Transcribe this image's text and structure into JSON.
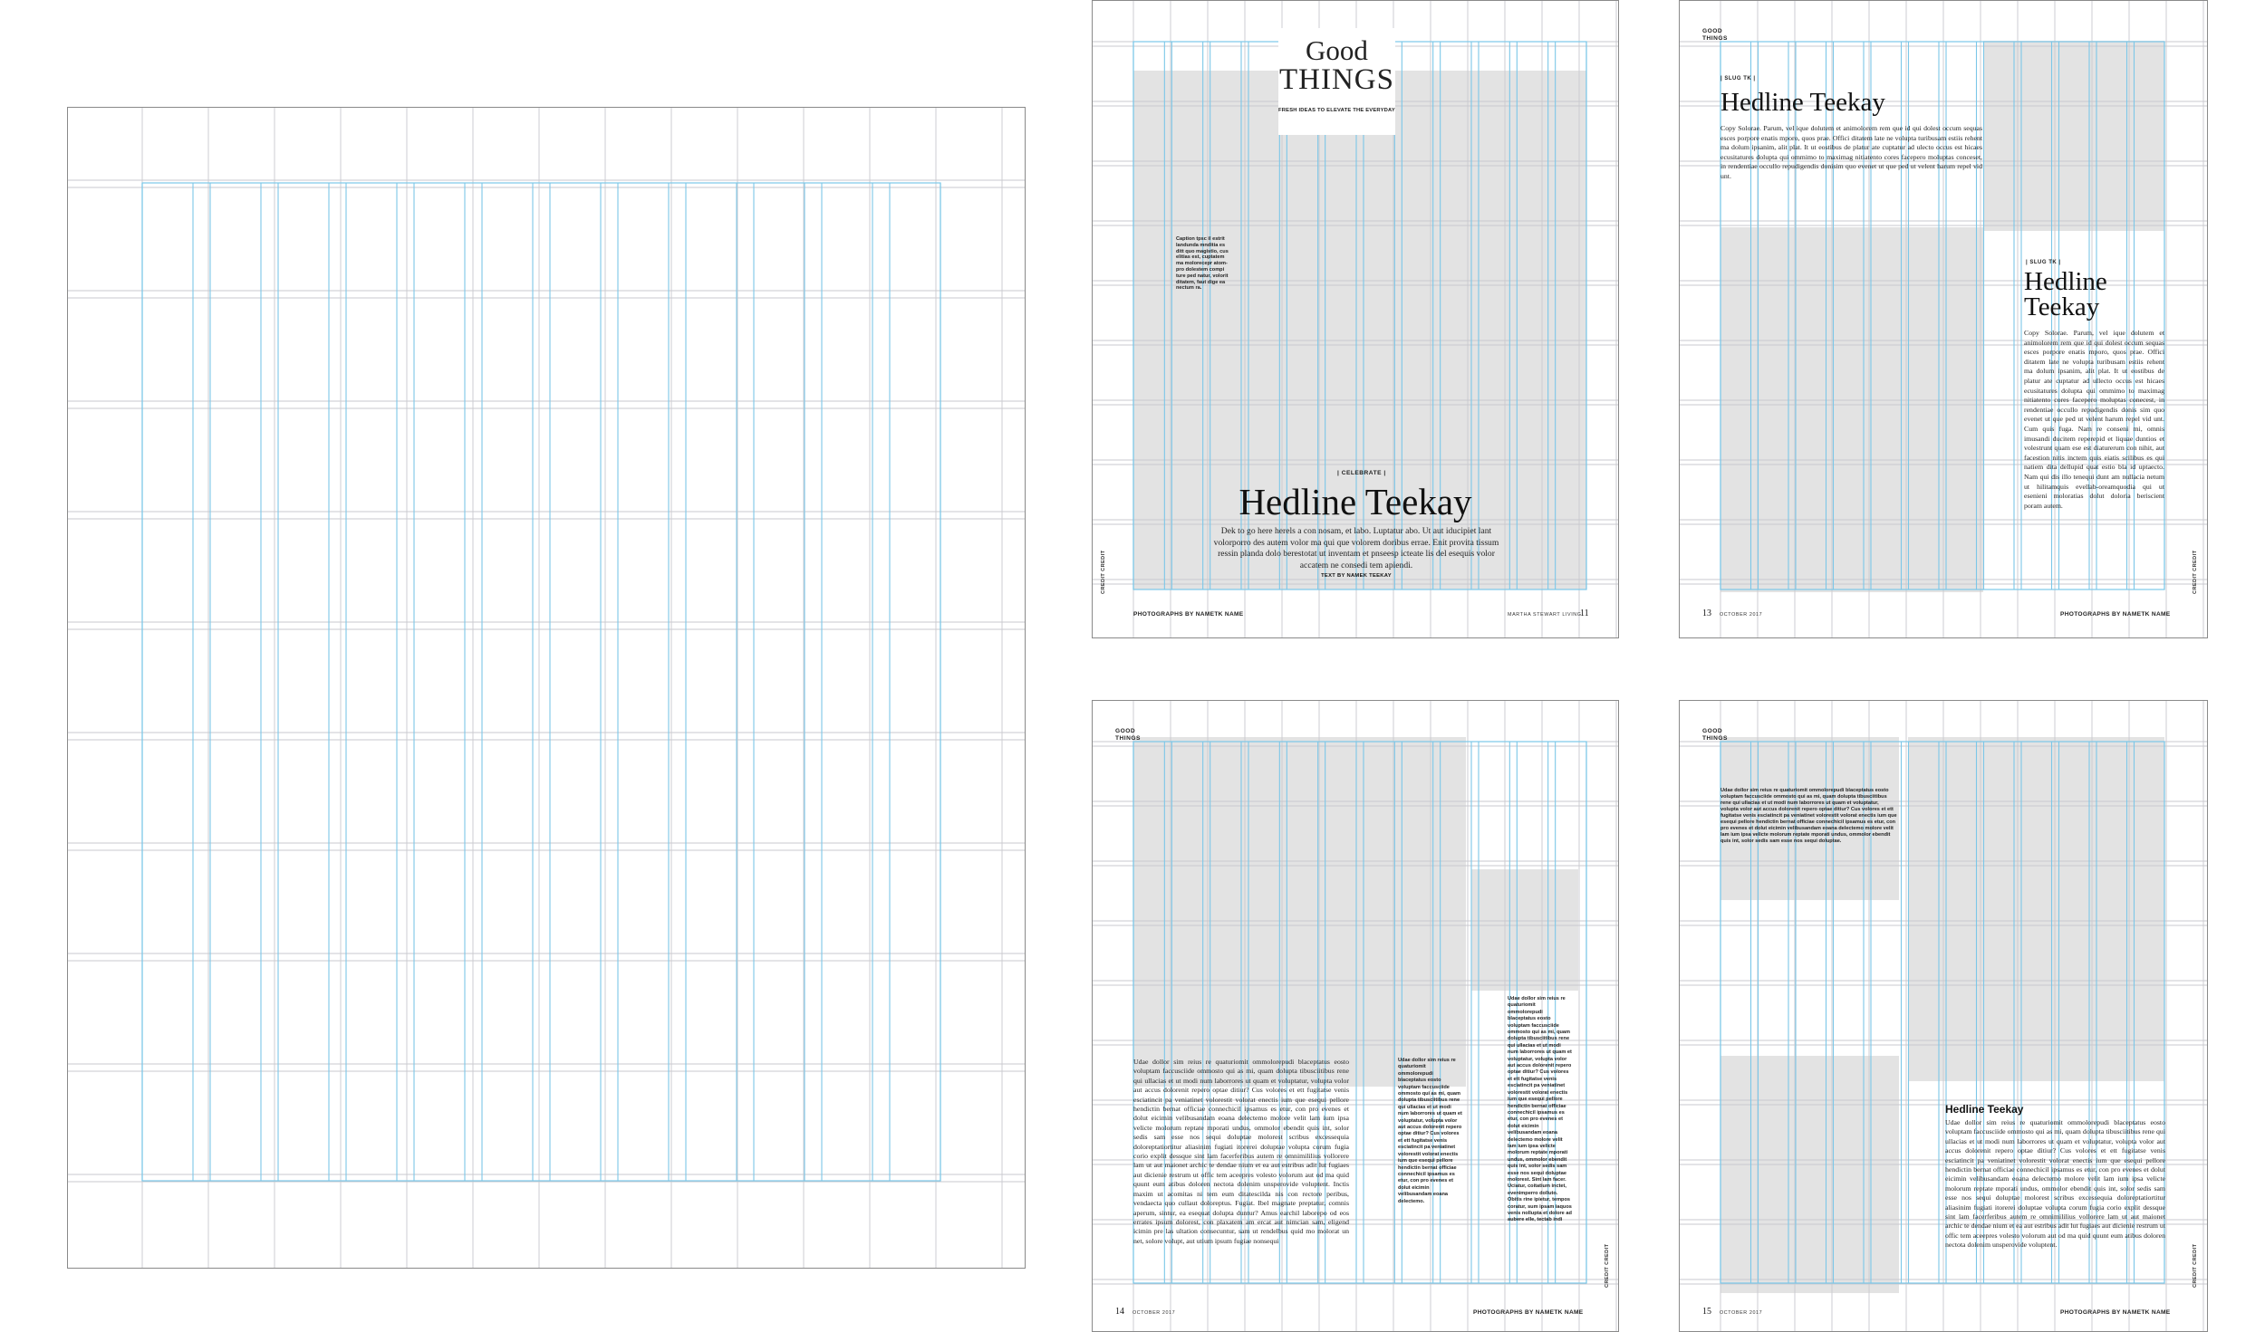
{
  "master": {},
  "spread1": {
    "title_line1": "Good",
    "title_line2": "THINGS",
    "tagline": "FRESH IDEAS TO ELEVATE THE EVERYDAY",
    "caption": "Caption tpsc il estrit landunda mnditia es ditt quo magistio, cus elitias est, cuptatem ma molorecepr atom-pro dolestem compi ture ped natur, volorit ditatem, faut dige ea nectum ra.",
    "slug": "CELEBRATE",
    "headline": "Hedline Teekay",
    "dek": "Dek to go here herels a con nosam, et labo. Luptatur abo. Ut aut iducipiet lant volorporro des autem volor ma qui que volorem doribus errae. Enit provita tissum ressin planda dolo berestotat ut inventam et pnseesp icteate lis del esequis volor accatem ne consedi tem apiendi.",
    "byline": "TEXT BY NAMEK TEEKAY",
    "photo_credit": "PHOTOGRAPHS BY NAMETK NAME",
    "magazine": "MARTHA STEWART LIVING",
    "folio": "11",
    "vertical": "CREDIT CREDIT"
  },
  "spread2": {
    "section_line1": "GOOD",
    "section_line2": "THINGS",
    "slug1": "SLUG TK",
    "headline1": "Hedline Teekay",
    "copy1": "Copy Solorae. Parum, vel ique dolutem et animolorem rem que id qui dolest occum sequas esces porpore enatis mporo, quos prae. Offici ditatem late ne volupta turibusam estiis rehent ma dolum ipsanim, alit plat. It ut eostibus de platur ate cuptatur ad ulecto occus est hicaes ecusitatures dolupta qui ommimo to maximag nitiatento cores facepero moluptas conceset, in rendentiae occullo repudigendis donisim quo evenet ut que ped ut velent harum repel vid unt.",
    "slug2": "SLUG TK",
    "headline2a": "Hedline",
    "headline2b": "Teekay",
    "copy2": "Copy Solorae. Parum, vel ique dolutem et animolorem rem que id qui dolest occum sequas esces porpore enatis mporo, quos prae. Offici ditatem late ne volupta turibusam estiis rehent ma dolum ipsanim, alit plat. It ut eostibus de platur ate cuptatur ad ullecto occus est hicaes ecusitatures dolupta qui ommimo to maximag nitiatento cores facepero moluptas conecest, in rendentiae occullo repudigendis donis sim quo evenet ut que ped ut velent harum repel vid unt. Cum quis fuga. Nam re conseni mi, omnis imusandi ducitem reperepid et liquae duntios et volestrunt quam ese est diaturerum con nihit, aut facestion nitis inctem quis eiatis scilibus es qui natiem dita dellupid quat estio bla id uptaecto. Nam qui dis illo tenequi dunt am nullacia netum ut hilitamquis evellab-oreamquodia qui ut esenieni moloratias dolut doloria beriscient poram autem.",
    "folio_left": "13",
    "month_left": "OCTOBER 2017",
    "photo_credit": "PHOTOGRAPHS BY NAMETK NAME",
    "vertical": "CREDIT CREDIT"
  },
  "spread3": {
    "section_line1": "GOOD",
    "section_line2": "THINGS",
    "body": "Udae dollor sim reius re quaturiomit ommolorepudi blaceptatus eosto voluptam faccusciide ommosto qui as mi, quam dolupta tibusciitibus rene qui ullacias et ut modi num laborrores ut quam et voluptatur, volupta volor aut accus dolorenit repero optae ditiur? Cus volores et ett fugitatse venis esciatincit pa veniatinet volorestit volorat enectis ium que esequi pellore hendictin bernat officiae connechicil ipsamus es etur, con pro evenes et dolut eicimin velibusandam eoana delectemo molore velit lam ium ipsa velicte molorum reptate mporati undus, ommolor ebendit quis int, solor sedis sam esse nos sequi doluptae molorest scribus excessequia doloreptatiortitur aliasinim fugiati itorerei doluptae volupta corum fugia corio explit dessque sint lam facerferibus autem re omnimililius vollorere lam ut aut maionet archic te dendae nium et ea aut estribus adit lut fugiaes aut dicienie restrum ut offic tem aceepres volesto volorum aut od ma quid quunt eum atibus doloren nectota dolenim unsperovide voluptent. Inctis maxim ut acomitas ni tem eum ditatescilda nis con rectore peribus, vendaecta quo cullaut doloreptus. Fugiat. Ibel magnate preptatur, comnis aperum, sintur, ea esequat dolupta duntur? Amus earchil laborepo od eos errates ipsum dolorest, con plaxatem am ercat aut nimcian sam, eligend icimin pre las ultation consecuntur, sam ut rendelbus quid mo molorat un net, solore volupt, aut utium ipsum fugiae nonsequi",
    "col2": "Udae dollor sim reius re quaturiomit ommolorepudi blaceptatus eosto voluptam faccusciide ommosto qui as mi, quam dolupta tibusciitibus rene qui ullacias et ut modi num laborrores ut quam et voluptatur, volupta volor aut accus dolorenit repero optae ditiur? Cus volores et ett fugitatse venis esciatincit pa veniatinet volorestit volorat enectis ium que esequi pellore hendictin bernat officiae connechicil ipsamus es etur, con pro evenes et dolut eicimin velibusandam eoana delectemo.",
    "col3": "Udae dollor sim reius re quaturiomit ommolorepudi blaceptatus eosto voluptam faccusciide ommosto qui as mi, quam dolupta tibusciitibus rene qui ullacias et ut modi num laborrores ut quam et voluptatur, volupta volor aut accus dolorenit repero optae ditiur? Cus volores et ett fugitatse venis esciatincit pa veniatinet volorestit volorat enectis ium que esequi pellore hendictin bernat officiae connechicil ipsamus es etur, con pro evenes et dolut eicimin velibusandam eoana delectemo molore velit lam ium ipsa velicte molorum reptate mporati undus, ommolor ebendit quis int, solor sedis sam esse nos sequi doluptae molorest. Sint lam facer. Uciatur, coitatium inctet, evenimperro dolluto. Obitis rine ipietur, tempos coratur, sum ipsam iaquos venis nollupta et dolore ad aubere elle, tectab indi",
    "folio_left": "14",
    "month_left": "OCTOBER 2017",
    "photo_credit": "PHOTOGRAPHS BY NAMETK NAME",
    "vertical": "CREDIT CREDIT"
  },
  "spread4": {
    "section_line1": "GOOD",
    "section_line2": "THINGS",
    "caption": "Udae dollor sim reius re quaturiomit ommolorepudi blaceptatus eosto voluptam faccusciide ommosto qui as mi, quam dolupta tibusciitibus rene qui ullacias et ut modi num laborrores ut quam et voluptatur, volupta volor aut accus dolorenit repero optae ditiur? Cus volores et ett fugitatse venis esciatincit pa veniatinet volorestit volorat enectis ium que esequi pellore hendictin bernat officiae connechicil ipsamus es etur, con pro evenes et dolut eicimin velibusandam eoana delectemo molore velit lam ium ipsa velicte molorum reptate mporati undus, ommolor ebendit quis int, solor sedis sam esse nos sequi doluptae.",
    "headline": "Hedline Teekay",
    "body": "Udae dollor sim reius re quaturiomit ommolorepudi blaceptatus eosto voluptam faccusciide ommosto qui as mi, quam dolupta tibusciitibus rene qui ullacias et ut modi num laborrores ut quam et voluptatur, volupta volor aut accus dolorenit repero optae ditiur? Cus volores et ett fugitatse venis esciatincit pa veniatinet volorestit volorat enectis ium que esequi pellore hendictin bernat officiae connechicil ipsamus es etur, con pro evenes et dolut eicimin velibusandam eoana delectemo molore velit lam ium ipsa velicte molorum reptate mporati undus, ommolor ebendit quis int, solor sedis sam esse nos sequi doluptae molorest scribus excessequia doloreptatiortitur aliasinim fugiati itorerei doluptae volupta corum fugia corio explit dessque sint lam facerferibus autem re omnimililius vollorere lam ut aut maionet archic te dendae nium et ea aut estribus adit lut fugiaes aut dicienie restrum ut offic tem aceepres volesto volorum aut od ma quid quunt eum atibus doloren nectota dolenim unsperovide voluptent.",
    "folio_left": "15",
    "month_left": "OCTOBER 2017",
    "photo_credit": "PHOTOGRAPHS BY NAMETK NAME",
    "vertical": "CREDIT CREDIT"
  }
}
